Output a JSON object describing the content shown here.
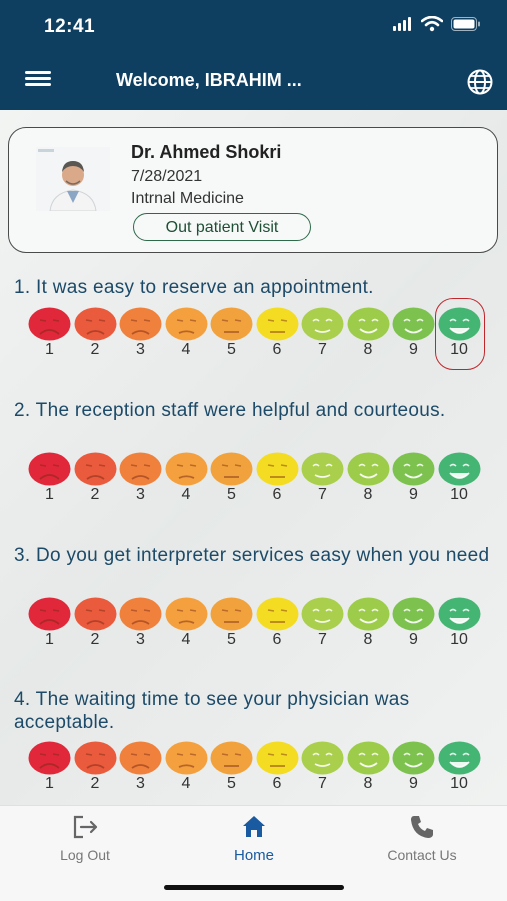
{
  "status_bar": {
    "time": "12:41"
  },
  "header": {
    "welcome": "Welcome, IBRAHIM ...",
    "menu_icon": "hamburger-menu-icon",
    "language_icon": "globe-icon"
  },
  "doctor": {
    "name": "Dr. Ahmed Shokri",
    "date": "7/28/2021",
    "specialty": "Intrnal Medicine",
    "visit_type": "Out patient Visit"
  },
  "questions": [
    {
      "text": "1. It was easy to reserve an appointment.",
      "selected": 10
    },
    {
      "text": "2. The reception staff were helpful and courteous.",
      "selected": null
    },
    {
      "text": "3. Do you get interpreter services easy when you need",
      "selected": null
    },
    {
      "text": "4. The waiting time to see your physician was acceptable.",
      "selected": null
    }
  ],
  "scale": [
    {
      "label": "1",
      "color": "#e0283a",
      "mood": "very-sad"
    },
    {
      "label": "2",
      "color": "#ea5a3c",
      "mood": "sad"
    },
    {
      "label": "3",
      "color": "#f0813c",
      "mood": "sad"
    },
    {
      "label": "4",
      "color": "#f4a03e",
      "mood": "slightly-sad"
    },
    {
      "label": "5",
      "color": "#f2a23c",
      "mood": "neutral"
    },
    {
      "label": "6",
      "color": "#f3dc22",
      "mood": "neutral"
    },
    {
      "label": "7",
      "color": "#a9cf4c",
      "mood": "slightly-happy"
    },
    {
      "label": "8",
      "color": "#9ccc4a",
      "mood": "happy"
    },
    {
      "label": "9",
      "color": "#7dc24e",
      "mood": "happy"
    },
    {
      "label": "10",
      "color": "#45b574",
      "mood": "very-happy"
    }
  ],
  "tabs": [
    {
      "label": "Log Out",
      "icon": "logout-icon",
      "active": false
    },
    {
      "label": "Home",
      "icon": "home-icon",
      "active": true
    },
    {
      "label": "Contact Us",
      "icon": "phone-icon",
      "active": false
    }
  ],
  "colors": {
    "header": "#0f3f60",
    "question_text": "#1c4a68",
    "active_tab": "#1a5aa0",
    "selected_ring": "#c0272d"
  }
}
